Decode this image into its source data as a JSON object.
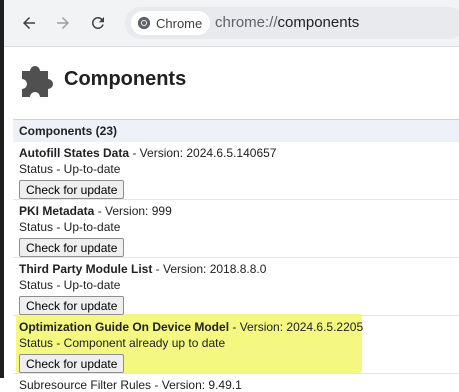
{
  "browser": {
    "chip_label": "Chrome",
    "url_scheme": "chrome://",
    "url_path": "components"
  },
  "page": {
    "title": "Components",
    "section_header": "Components (23)"
  },
  "components": [
    {
      "name": "Autofill States Data",
      "version_text": " - Version: 2024.6.5.140657",
      "status": "Status - Up-to-date",
      "button": "Check for update"
    },
    {
      "name": "PKI Metadata",
      "version_text": " - Version: 999",
      "status": "Status - Up-to-date",
      "button": "Check for update"
    },
    {
      "name": "Third Party Module List",
      "version_text": " - Version: 2018.8.8.0",
      "status": "Status - Up-to-date",
      "button": "Check for update"
    },
    {
      "name": "Optimization Guide On Device Model",
      "version_text": " - Version: 2024.6.5.2205",
      "status": "Status - Component already up to date",
      "button": "Check for update"
    },
    {
      "name": "Subresource Filter Rules",
      "version_text": " - Version: 9.49.1",
      "status": "",
      "button": ""
    }
  ],
  "highlight_color": "#f3f76a"
}
